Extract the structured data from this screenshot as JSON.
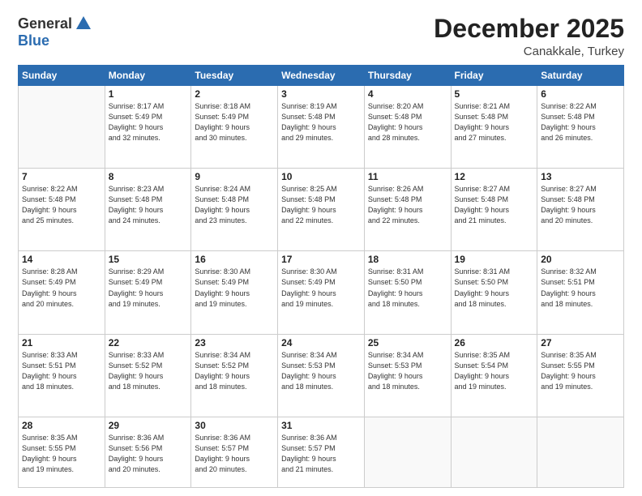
{
  "header": {
    "logo_general": "General",
    "logo_blue": "Blue",
    "month_title": "December 2025",
    "location": "Canakkale, Turkey"
  },
  "days_of_week": [
    "Sunday",
    "Monday",
    "Tuesday",
    "Wednesday",
    "Thursday",
    "Friday",
    "Saturday"
  ],
  "weeks": [
    [
      {
        "day": "",
        "info": ""
      },
      {
        "day": "1",
        "info": "Sunrise: 8:17 AM\nSunset: 5:49 PM\nDaylight: 9 hours\nand 32 minutes."
      },
      {
        "day": "2",
        "info": "Sunrise: 8:18 AM\nSunset: 5:49 PM\nDaylight: 9 hours\nand 30 minutes."
      },
      {
        "day": "3",
        "info": "Sunrise: 8:19 AM\nSunset: 5:48 PM\nDaylight: 9 hours\nand 29 minutes."
      },
      {
        "day": "4",
        "info": "Sunrise: 8:20 AM\nSunset: 5:48 PM\nDaylight: 9 hours\nand 28 minutes."
      },
      {
        "day": "5",
        "info": "Sunrise: 8:21 AM\nSunset: 5:48 PM\nDaylight: 9 hours\nand 27 minutes."
      },
      {
        "day": "6",
        "info": "Sunrise: 8:22 AM\nSunset: 5:48 PM\nDaylight: 9 hours\nand 26 minutes."
      }
    ],
    [
      {
        "day": "7",
        "info": ""
      },
      {
        "day": "8",
        "info": "Sunrise: 8:23 AM\nSunset: 5:48 PM\nDaylight: 9 hours\nand 24 minutes."
      },
      {
        "day": "9",
        "info": "Sunrise: 8:24 AM\nSunset: 5:48 PM\nDaylight: 9 hours\nand 23 minutes."
      },
      {
        "day": "10",
        "info": "Sunrise: 8:25 AM\nSunset: 5:48 PM\nDaylight: 9 hours\nand 22 minutes."
      },
      {
        "day": "11",
        "info": "Sunrise: 8:26 AM\nSunset: 5:48 PM\nDaylight: 9 hours\nand 22 minutes."
      },
      {
        "day": "12",
        "info": "Sunrise: 8:27 AM\nSunset: 5:48 PM\nDaylight: 9 hours\nand 21 minutes."
      },
      {
        "day": "13",
        "info": "Sunrise: 8:27 AM\nSunset: 5:48 PM\nDaylight: 9 hours\nand 20 minutes."
      }
    ],
    [
      {
        "day": "14",
        "info": ""
      },
      {
        "day": "15",
        "info": "Sunrise: 8:29 AM\nSunset: 5:49 PM\nDaylight: 9 hours\nand 19 minutes."
      },
      {
        "day": "16",
        "info": "Sunrise: 8:30 AM\nSunset: 5:49 PM\nDaylight: 9 hours\nand 19 minutes."
      },
      {
        "day": "17",
        "info": "Sunrise: 8:30 AM\nSunset: 5:49 PM\nDaylight: 9 hours\nand 19 minutes."
      },
      {
        "day": "18",
        "info": "Sunrise: 8:31 AM\nSunset: 5:50 PM\nDaylight: 9 hours\nand 18 minutes."
      },
      {
        "day": "19",
        "info": "Sunrise: 8:31 AM\nSunset: 5:50 PM\nDaylight: 9 hours\nand 18 minutes."
      },
      {
        "day": "20",
        "info": "Sunrise: 8:32 AM\nSunset: 5:51 PM\nDaylight: 9 hours\nand 18 minutes."
      }
    ],
    [
      {
        "day": "21",
        "info": "Sunrise: 8:33 AM\nSunset: 5:51 PM\nDaylight: 9 hours\nand 18 minutes."
      },
      {
        "day": "22",
        "info": "Sunrise: 8:33 AM\nSunset: 5:52 PM\nDaylight: 9 hours\nand 18 minutes."
      },
      {
        "day": "23",
        "info": "Sunrise: 8:34 AM\nSunset: 5:52 PM\nDaylight: 9 hours\nand 18 minutes."
      },
      {
        "day": "24",
        "info": "Sunrise: 8:34 AM\nSunset: 5:53 PM\nDaylight: 9 hours\nand 18 minutes."
      },
      {
        "day": "25",
        "info": "Sunrise: 8:34 AM\nSunset: 5:53 PM\nDaylight: 9 hours\nand 18 minutes."
      },
      {
        "day": "26",
        "info": "Sunrise: 8:35 AM\nSunset: 5:54 PM\nDaylight: 9 hours\nand 19 minutes."
      },
      {
        "day": "27",
        "info": "Sunrise: 8:35 AM\nSunset: 5:55 PM\nDaylight: 9 hours\nand 19 minutes."
      }
    ],
    [
      {
        "day": "28",
        "info": "Sunrise: 8:35 AM\nSunset: 5:55 PM\nDaylight: 9 hours\nand 19 minutes."
      },
      {
        "day": "29",
        "info": "Sunrise: 8:36 AM\nSunset: 5:56 PM\nDaylight: 9 hours\nand 20 minutes."
      },
      {
        "day": "30",
        "info": "Sunrise: 8:36 AM\nSunset: 5:57 PM\nDaylight: 9 hours\nand 20 minutes."
      },
      {
        "day": "31",
        "info": "Sunrise: 8:36 AM\nSunset: 5:57 PM\nDaylight: 9 hours\nand 21 minutes."
      },
      {
        "day": "",
        "info": ""
      },
      {
        "day": "",
        "info": ""
      },
      {
        "day": "",
        "info": ""
      }
    ]
  ],
  "week1_day7_info": "Sunrise: 8:22 AM\nSunset: 5:48 PM\nDaylight: 9 hours\nand 25 minutes.",
  "week2_day14_info": "Sunrise: 8:28 AM\nSunset: 5:49 PM\nDaylight: 9 hours\nand 20 minutes."
}
